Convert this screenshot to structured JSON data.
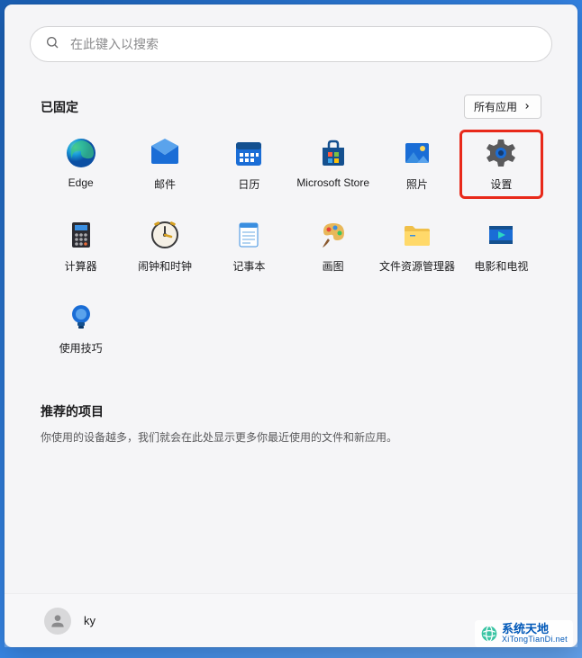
{
  "search": {
    "placeholder": "在此键入以搜索"
  },
  "pinned": {
    "title": "已固定",
    "all_apps_label": "所有应用",
    "apps": [
      {
        "id": "edge",
        "label": "Edge"
      },
      {
        "id": "mail",
        "label": "邮件"
      },
      {
        "id": "calendar",
        "label": "日历"
      },
      {
        "id": "store",
        "label": "Microsoft Store"
      },
      {
        "id": "photos",
        "label": "照片"
      },
      {
        "id": "settings",
        "label": "设置",
        "highlighted": true
      },
      {
        "id": "calculator",
        "label": "计算器"
      },
      {
        "id": "clock",
        "label": "闹钟和时钟"
      },
      {
        "id": "notepad",
        "label": "记事本"
      },
      {
        "id": "paint",
        "label": "画图"
      },
      {
        "id": "explorer",
        "label": "文件资源管理器"
      },
      {
        "id": "movies",
        "label": "电影和电视"
      },
      {
        "id": "tips",
        "label": "使用技巧"
      }
    ]
  },
  "recommended": {
    "title": "推荐的项目",
    "empty_text": "你使用的设备越多，我们就会在此处显示更多你最近使用的文件和新应用。"
  },
  "user": {
    "name": "ky"
  },
  "watermark": {
    "main": "系统天地",
    "sub": "XiTongTianDi.net"
  }
}
